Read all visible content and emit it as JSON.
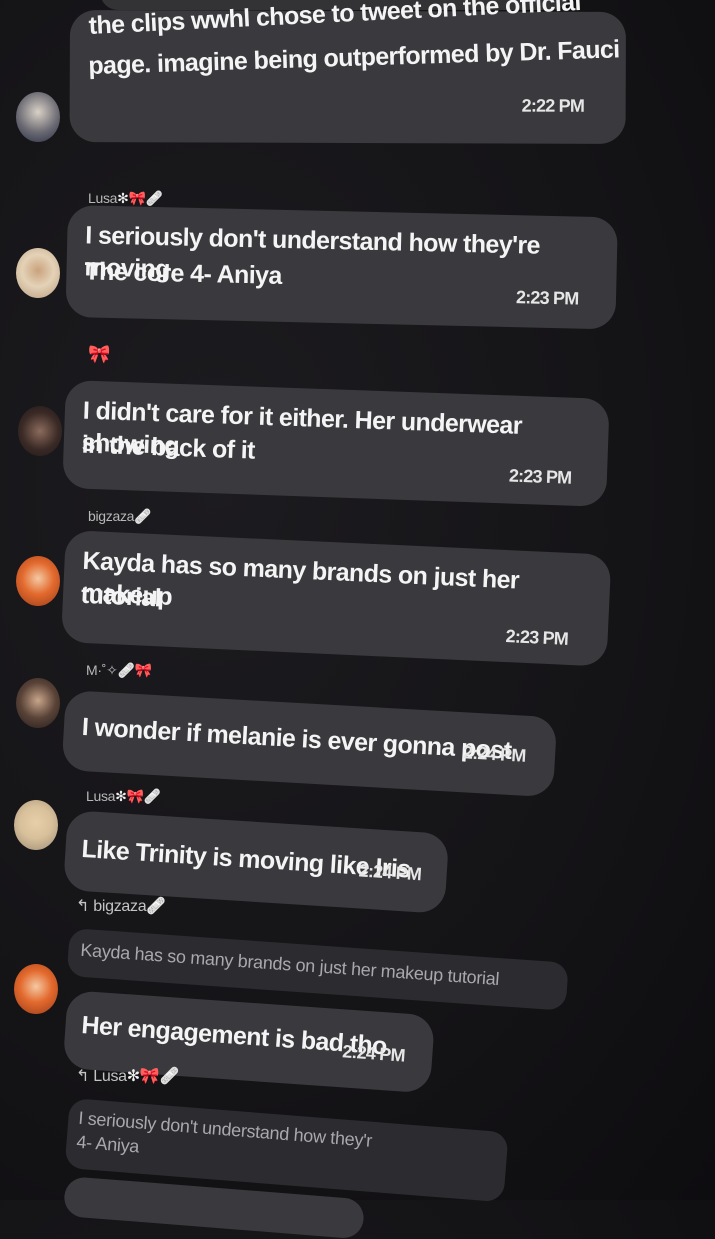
{
  "messages": [
    {
      "id": "m1",
      "sender": "",
      "text_lines": [
        "the clips wwhl chose to tweet on the official",
        "page. imagine being outperformed by Dr. Fauci"
      ],
      "time": "2:22 PM",
      "avatar": "avatar-user-1"
    },
    {
      "id": "m2",
      "sender": "Lusa",
      "sender_suffix": "🎀",
      "sender_mark": "🩹",
      "text_lines": [
        "I seriously don't understand how they're moving.",
        "The core 4- Aniya"
      ],
      "time": "2:23 PM",
      "avatar": "avatar-lusa"
    },
    {
      "id": "m3",
      "sender": "🎀",
      "text_lines": [
        "I didn't care for it either. Her underwear showing",
        "in the back of it"
      ],
      "time": "2:23 PM",
      "avatar": "avatar-bow"
    },
    {
      "id": "m4",
      "sender": "bigzaza",
      "sender_mark": "🩹",
      "text_lines": [
        "Kayda has so many brands on just her makeup",
        "tutorial"
      ],
      "time": "2:23 PM",
      "avatar": "avatar-bigzaza"
    },
    {
      "id": "m5",
      "sender": "M·˚✧",
      "sender_mark": "🩹",
      "sender_suffix": "🎀",
      "text_lines": [
        "I wonder if melanie is ever gonna post"
      ],
      "time": "2:24 PM",
      "avatar": "avatar-m"
    },
    {
      "id": "m6",
      "sender": "Lusa",
      "sender_suffix": "🎀",
      "sender_mark": "🩹",
      "text_lines": [
        "Like Trinity is moving like Iris"
      ],
      "time": "2:24 PM",
      "avatar": "avatar-lusa"
    },
    {
      "id": "m7",
      "reply_to": "bigzaza",
      "reply_mark": "🩹",
      "reply_text": "Kayda has so many brands on just her makeup tutorial",
      "text_lines": [
        "Her engagement is bad tho"
      ],
      "time": "2:24 PM",
      "avatar": "avatar-bigzaza"
    },
    {
      "id": "m8",
      "reply_to": "Lusa",
      "reply_suffix": "🎀",
      "reply_mark": "🩹",
      "reply_text_lines": [
        "I seriously don't understand how they'r",
        "4- Aniya"
      ]
    }
  ],
  "icons": {
    "reply": "reply-arrow-icon",
    "bow": "pink-bow-icon",
    "bandage": "bandage-icon"
  },
  "colors": {
    "bubble": "#3a3a3e",
    "background": "#141316",
    "bow": "#ff8fb8"
  }
}
